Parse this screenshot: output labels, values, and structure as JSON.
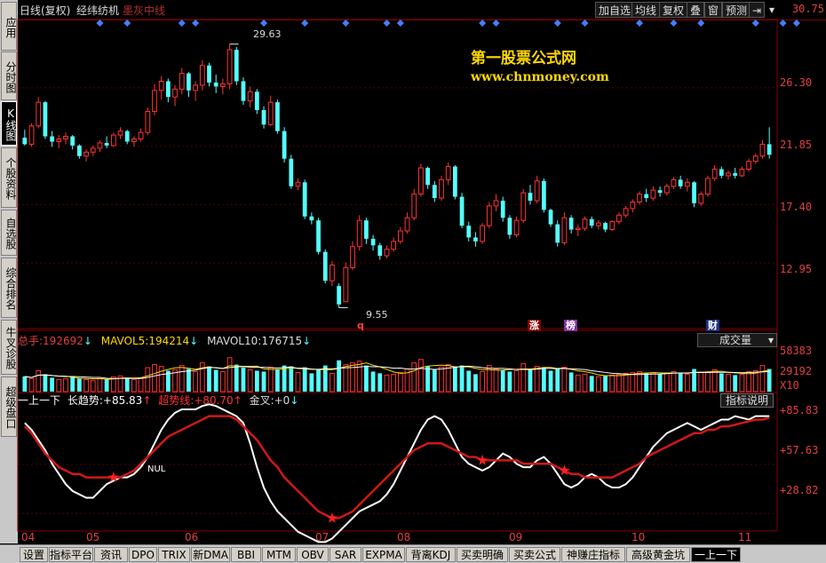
{
  "sidebar": {
    "tabs": [
      {
        "label": "应用",
        "active": false
      },
      {
        "label": "分时图",
        "active": false
      },
      {
        "label": "K线图",
        "active": true
      },
      {
        "label": "个股资料",
        "active": false
      },
      {
        "label": "自选股",
        "active": false
      },
      {
        "label": "综合排名",
        "active": false
      },
      {
        "label": "牛叉诊股",
        "active": false
      },
      {
        "label": "超级盘口",
        "active": false
      }
    ]
  },
  "header": {
    "period": "日线(复权)",
    "stock_name": "经纬纺机",
    "indicator": "墨灰中线",
    "buttons": [
      "加自选",
      "均线",
      "复权",
      "叠",
      "窗",
      "预测"
    ],
    "icons": [
      "arrow-to-right-icon",
      "dropdown-arrow-icon"
    ]
  },
  "watermark": {
    "line1": "第一股票公式网",
    "line2": "www.chnmoney.com"
  },
  "price_axis": [
    "30.75",
    "26.30",
    "21.85",
    "17.40",
    "12.95"
  ],
  "annotations": {
    "high": "29.63",
    "low": "9.55"
  },
  "event_marks": [
    "q",
    "涨",
    "榜",
    "财"
  ],
  "volume": {
    "label1": "总手:",
    "value1": "192692",
    "label2": "MAVOL5:",
    "value2": "194214",
    "label3": "MAVOL10:",
    "value3": "176715",
    "dropdown": "成交量",
    "axis": [
      "58383",
      "29192",
      "X10"
    ]
  },
  "indicator_panel": {
    "name": "一上一下",
    "label1": "长趋势:",
    "value1": "+85.83",
    "label2": "超势线:",
    "value2": "+80.70",
    "label3": "金叉:",
    "value3": "+0",
    "help_button": "指标说明",
    "axis": [
      "+85.83",
      "+57.63",
      "+28.82"
    ],
    "nul_label": "NUL"
  },
  "x_axis": [
    "04",
    "05",
    "06",
    "07",
    "08",
    "09",
    "10",
    "11"
  ],
  "bottom_tabs": [
    "设置",
    "指标平台",
    "资讯",
    "DPO",
    "TRIX",
    "新DMA",
    "BBI",
    "MTM",
    "OBV",
    "SAR",
    "EXPMA",
    "背离KDJ",
    "买卖明确",
    "买卖公式",
    "神赚庄指标",
    "高级黄金坑",
    "一上一下"
  ],
  "colors": {
    "up": "#ff3333",
    "down": "#54ffff",
    "axis": "#800000",
    "text_red": "#e04040",
    "white_line": "#ffffff",
    "red_line": "#d01818",
    "star": "#ff2020",
    "diamond": "#4080ff"
  },
  "chart_data": {
    "type": "candlestick",
    "y_range": [
      8.5,
      31.5
    ],
    "candles": [
      [
        22.5,
        23.1,
        21.9,
        22.0
      ],
      [
        22.0,
        23.6,
        21.8,
        23.4
      ],
      [
        23.4,
        25.6,
        23.2,
        25.2
      ],
      [
        25.2,
        25.3,
        22.4,
        22.6
      ],
      [
        22.6,
        23.0,
        21.8,
        22.2
      ],
      [
        22.2,
        22.7,
        21.7,
        22.4
      ],
      [
        22.4,
        22.9,
        22.0,
        22.6
      ],
      [
        22.6,
        22.7,
        21.6,
        21.9
      ],
      [
        21.9,
        22.0,
        20.9,
        21.1
      ],
      [
        21.1,
        21.6,
        20.7,
        21.4
      ],
      [
        21.4,
        21.9,
        21.1,
        21.7
      ],
      [
        21.7,
        22.3,
        21.4,
        22.1
      ],
      [
        22.1,
        22.6,
        21.7,
        21.9
      ],
      [
        21.9,
        22.9,
        21.8,
        22.7
      ],
      [
        22.7,
        23.3,
        22.4,
        23.0
      ],
      [
        23.0,
        23.1,
        22.0,
        22.2
      ],
      [
        22.2,
        22.6,
        21.8,
        22.4
      ],
      [
        22.4,
        23.2,
        22.2,
        22.9
      ],
      [
        22.9,
        24.8,
        22.7,
        24.5
      ],
      [
        24.5,
        26.6,
        24.2,
        26.1
      ],
      [
        26.1,
        27.2,
        25.4,
        26.8
      ],
      [
        26.8,
        27.0,
        25.2,
        25.6
      ],
      [
        25.6,
        26.5,
        24.9,
        26.2
      ],
      [
        26.2,
        27.8,
        25.8,
        27.4
      ],
      [
        27.4,
        27.5,
        25.6,
        26.1
      ],
      [
        26.1,
        26.8,
        25.3,
        26.5
      ],
      [
        26.5,
        28.4,
        26.1,
        28.0
      ],
      [
        28.0,
        28.2,
        26.4,
        26.7
      ],
      [
        26.7,
        27.3,
        25.9,
        26.4
      ],
      [
        26.4,
        27.0,
        25.8,
        26.6
      ],
      [
        26.6,
        29.63,
        26.2,
        29.2
      ],
      [
        29.2,
        29.4,
        26.5,
        26.8
      ],
      [
        26.8,
        27.1,
        25.0,
        25.3
      ],
      [
        25.3,
        26.4,
        24.8,
        26.0
      ],
      [
        26.0,
        26.2,
        24.3,
        24.6
      ],
      [
        24.6,
        24.9,
        23.2,
        23.5
      ],
      [
        23.5,
        25.7,
        23.4,
        25.2
      ],
      [
        25.2,
        25.4,
        22.8,
        23.0
      ],
      [
        23.0,
        23.3,
        20.6,
        20.9
      ],
      [
        20.9,
        21.2,
        18.6,
        18.8
      ],
      [
        18.8,
        19.4,
        18.5,
        19.1
      ],
      [
        19.1,
        19.3,
        16.3,
        16.5
      ],
      [
        16.5,
        16.8,
        15.9,
        16.2
      ],
      [
        16.2,
        16.4,
        13.6,
        13.8
      ],
      [
        13.8,
        14.0,
        11.4,
        11.6
      ],
      [
        11.6,
        13.1,
        11.2,
        12.8
      ],
      [
        11.2,
        11.4,
        9.55,
        9.8
      ],
      [
        10.0,
        13.0,
        10.0,
        12.6
      ],
      [
        12.6,
        14.6,
        12.4,
        14.2
      ],
      [
        14.2,
        16.6,
        13.9,
        16.2
      ],
      [
        16.2,
        16.4,
        14.4,
        14.8
      ],
      [
        14.8,
        15.1,
        13.9,
        14.3
      ],
      [
        14.3,
        14.5,
        13.2,
        13.5
      ],
      [
        13.5,
        14.3,
        13.3,
        14.0
      ],
      [
        14.0,
        14.9,
        13.8,
        14.6
      ],
      [
        14.6,
        15.7,
        14.4,
        15.4
      ],
      [
        15.4,
        16.8,
        15.2,
        16.4
      ],
      [
        16.4,
        18.6,
        16.2,
        18.2
      ],
      [
        18.2,
        20.5,
        18.0,
        20.2
      ],
      [
        20.2,
        20.3,
        18.6,
        18.9
      ],
      [
        18.9,
        19.2,
        17.6,
        17.9
      ],
      [
        17.9,
        19.6,
        17.7,
        19.3
      ],
      [
        19.3,
        20.6,
        18.9,
        20.3
      ],
      [
        20.3,
        20.4,
        17.8,
        18.0
      ],
      [
        18.0,
        18.3,
        15.6,
        15.8
      ],
      [
        15.8,
        16.1,
        14.6,
        14.9
      ],
      [
        14.9,
        15.3,
        14.2,
        14.6
      ],
      [
        14.6,
        16.0,
        14.4,
        15.8
      ],
      [
        15.8,
        17.6,
        15.6,
        17.3
      ],
      [
        17.3,
        18.2,
        16.9,
        17.7
      ],
      [
        17.7,
        18.0,
        16.1,
        16.4
      ],
      [
        16.4,
        16.6,
        14.8,
        15.1
      ],
      [
        15.1,
        16.5,
        14.9,
        16.2
      ],
      [
        16.2,
        18.6,
        16.0,
        18.3
      ],
      [
        18.3,
        18.9,
        17.4,
        17.7
      ],
      [
        17.7,
        19.6,
        17.5,
        19.2
      ],
      [
        19.2,
        19.4,
        16.8,
        17.0
      ],
      [
        17.0,
        17.1,
        15.7,
        15.9
      ],
      [
        15.9,
        16.2,
        14.2,
        14.5
      ],
      [
        14.5,
        16.8,
        14.3,
        16.4
      ],
      [
        16.4,
        16.6,
        15.2,
        15.5
      ],
      [
        15.5,
        15.9,
        15.0,
        15.6
      ],
      [
        15.6,
        16.5,
        15.4,
        16.3
      ],
      [
        16.3,
        16.5,
        15.6,
        15.8
      ],
      [
        15.8,
        16.2,
        15.5,
        16.0
      ],
      [
        16.0,
        16.1,
        15.3,
        15.5
      ],
      [
        15.5,
        16.2,
        15.4,
        16.1
      ],
      [
        16.1,
        16.8,
        15.9,
        16.6
      ],
      [
        16.6,
        17.3,
        16.4,
        17.1
      ],
      [
        17.1,
        17.8,
        16.8,
        17.6
      ],
      [
        17.6,
        18.4,
        17.4,
        18.2
      ],
      [
        18.2,
        18.6,
        17.6,
        17.9
      ],
      [
        17.9,
        18.8,
        17.7,
        18.5
      ],
      [
        18.5,
        18.8,
        18.0,
        18.3
      ],
      [
        18.3,
        19.0,
        18.1,
        18.8
      ],
      [
        18.8,
        19.5,
        18.6,
        19.3
      ],
      [
        19.3,
        19.6,
        18.6,
        18.8
      ],
      [
        18.8,
        19.4,
        18.4,
        19.1
      ],
      [
        19.1,
        19.2,
        17.2,
        17.5
      ],
      [
        17.5,
        18.4,
        17.3,
        18.2
      ],
      [
        18.2,
        19.6,
        18.0,
        19.4
      ],
      [
        19.4,
        20.4,
        19.2,
        20.1
      ],
      [
        20.1,
        20.3,
        19.4,
        19.6
      ],
      [
        19.6,
        20.0,
        19.3,
        19.8
      ],
      [
        19.8,
        20.2,
        19.4,
        19.6
      ],
      [
        19.6,
        20.3,
        19.5,
        20.1
      ],
      [
        20.1,
        20.9,
        19.9,
        20.7
      ],
      [
        20.7,
        21.3,
        20.5,
        21.1
      ],
      [
        21.1,
        22.3,
        20.9,
        22.0
      ],
      [
        22.0,
        23.3,
        20.9,
        21.2
      ]
    ],
    "volume": [
      0.35,
      0.3,
      0.48,
      0.4,
      0.32,
      0.28,
      0.3,
      0.34,
      0.3,
      0.28,
      0.26,
      0.3,
      0.28,
      0.34,
      0.36,
      0.3,
      0.28,
      0.32,
      0.55,
      0.62,
      0.58,
      0.48,
      0.5,
      0.6,
      0.52,
      0.46,
      0.66,
      0.58,
      0.5,
      0.46,
      0.78,
      0.62,
      0.55,
      0.5,
      0.48,
      0.46,
      0.56,
      0.52,
      0.6,
      0.58,
      0.44,
      0.56,
      0.42,
      0.52,
      0.6,
      0.42,
      0.72,
      0.62,
      0.66,
      0.7,
      0.6,
      0.46,
      0.42,
      0.38,
      0.4,
      0.44,
      0.52,
      0.66,
      0.74,
      0.58,
      0.5,
      0.56,
      0.62,
      0.58,
      0.6,
      0.48,
      0.4,
      0.46,
      0.6,
      0.52,
      0.5,
      0.46,
      0.48,
      0.64,
      0.52,
      0.58,
      0.56,
      0.48,
      0.52,
      0.56,
      0.44,
      0.38,
      0.4,
      0.36,
      0.34,
      0.36,
      0.38,
      0.4,
      0.42,
      0.44,
      0.46,
      0.42,
      0.44,
      0.4,
      0.42,
      0.46,
      0.42,
      0.4,
      0.52,
      0.44,
      0.46,
      0.5,
      0.42,
      0.4,
      0.38,
      0.4,
      0.46,
      0.48,
      0.6,
      0.52
    ],
    "white_line": [
      82,
      78,
      72,
      66,
      58,
      52,
      46,
      42,
      40,
      38,
      38,
      42,
      46,
      48,
      50,
      50,
      52,
      56,
      62,
      70,
      78,
      84,
      88,
      90,
      90,
      90,
      92,
      93,
      92,
      90,
      88,
      86,
      82,
      70,
      56,
      44,
      36,
      30,
      26,
      22,
      18,
      16,
      14,
      12,
      12,
      14,
      18,
      22,
      26,
      30,
      32,
      34,
      36,
      40,
      46,
      54,
      62,
      70,
      78,
      84,
      86,
      84,
      78,
      70,
      62,
      58,
      56,
      54,
      56,
      60,
      64,
      62,
      58,
      56,
      56,
      60,
      62,
      58,
      52,
      46,
      44,
      46,
      50,
      52,
      50,
      46,
      44,
      44,
      46,
      50,
      56,
      62,
      68,
      72,
      76,
      78,
      80,
      82,
      80,
      78,
      80,
      82,
      84,
      84,
      86,
      85,
      84,
      86,
      86,
      86
    ],
    "red_line": [
      80,
      76,
      70,
      64,
      60,
      56,
      54,
      52,
      52,
      50,
      50,
      50,
      50,
      50,
      50,
      52,
      54,
      58,
      62,
      66,
      70,
      74,
      76,
      78,
      80,
      82,
      84,
      86,
      86,
      86,
      86,
      84,
      80,
      76,
      72,
      66,
      60,
      56,
      50,
      46,
      42,
      38,
      34,
      30,
      28,
      26,
      26,
      28,
      30,
      34,
      38,
      42,
      46,
      50,
      54,
      58,
      62,
      66,
      68,
      70,
      70,
      70,
      68,
      66,
      64,
      62,
      62,
      60,
      60,
      60,
      60,
      60,
      60,
      58,
      58,
      58,
      58,
      58,
      56,
      54,
      52,
      52,
      50,
      50,
      50,
      50,
      50,
      52,
      54,
      56,
      58,
      62,
      64,
      66,
      68,
      70,
      72,
      74,
      76,
      76,
      78,
      78,
      80,
      80,
      81,
      82,
      83,
      84,
      84,
      85
    ],
    "stars_at": [
      13,
      45,
      67,
      79
    ],
    "diamonds_at": [
      11,
      15,
      23,
      25,
      35,
      41,
      47,
      53,
      55,
      67,
      69,
      78,
      82,
      90,
      95,
      99,
      107,
      111,
      113
    ]
  }
}
